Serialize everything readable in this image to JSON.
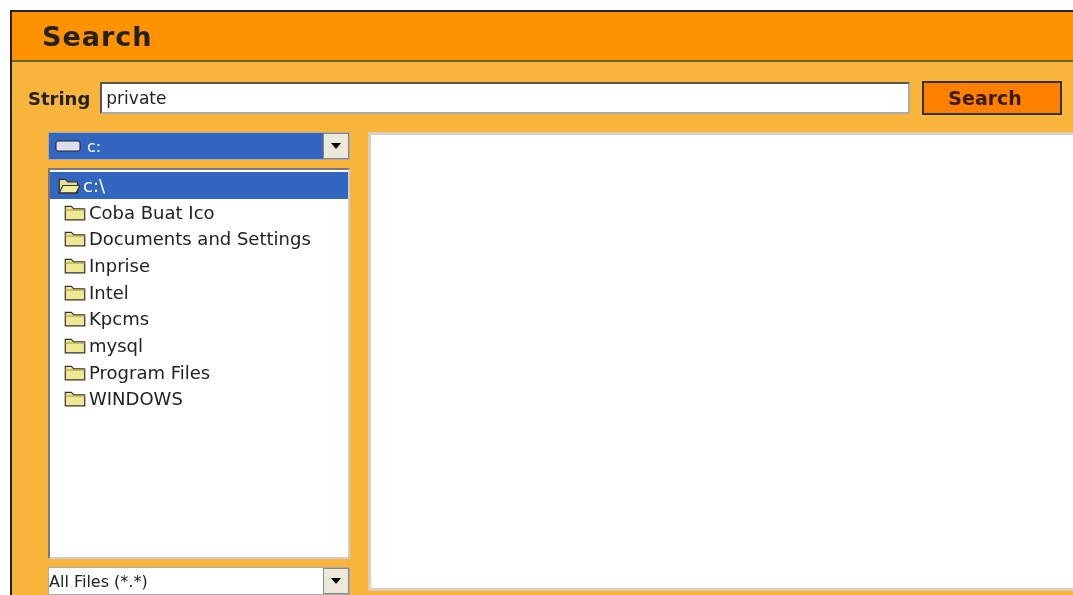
{
  "window": {
    "title": "Search"
  },
  "search": {
    "label": "String",
    "value": "private",
    "button": "Search"
  },
  "drive": {
    "value": "c:"
  },
  "tree": [
    {
      "label": "c:\\",
      "selected": true,
      "expanded": true,
      "children": [
        {
          "label": "Coba Buat Ico",
          "selected": false
        },
        {
          "label": "Documents and Settings",
          "selected": false
        },
        {
          "label": "Inprise",
          "selected": false
        },
        {
          "label": "Intel",
          "selected": false
        },
        {
          "label": "Kpcms",
          "selected": false
        },
        {
          "label": "mysql",
          "selected": false
        },
        {
          "label": "Program Files",
          "selected": false
        },
        {
          "label": "WINDOWS",
          "selected": false
        }
      ]
    }
  ],
  "filter": {
    "value": "All Files (*.*)"
  }
}
